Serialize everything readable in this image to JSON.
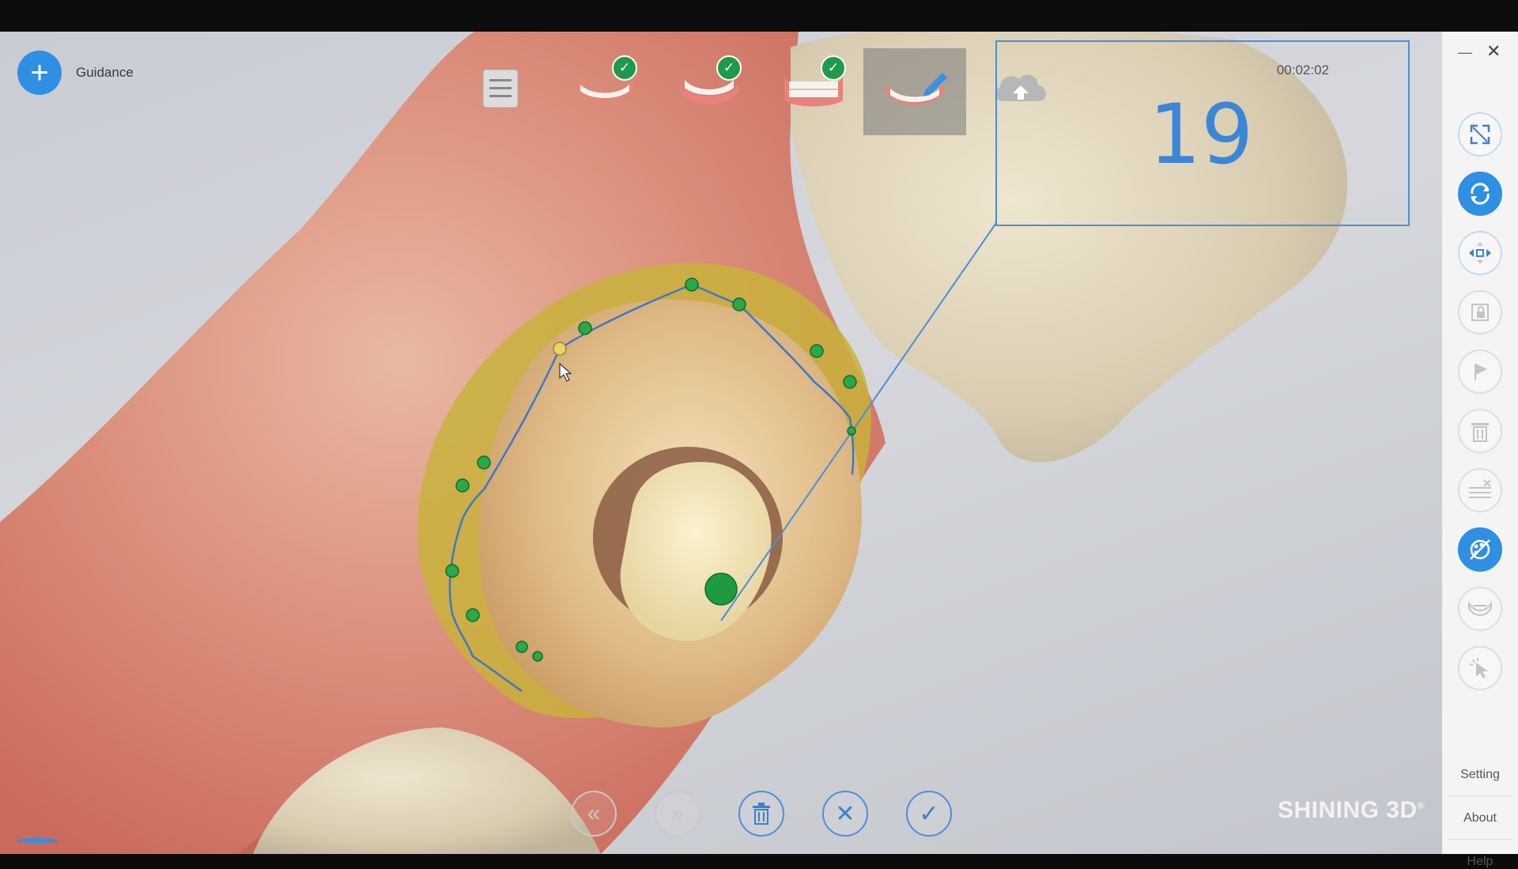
{
  "app": {
    "guidance_label": "Guidance",
    "brand": "SHINING 3D",
    "brand_mark": "®",
    "accent_color": "#2f8fe3"
  },
  "top_toolbar": {
    "stages": [
      {
        "icon": "list-icon",
        "completed": false
      },
      {
        "icon": "upper-jaw-icon",
        "completed": true
      },
      {
        "icon": "lower-jaw-icon",
        "completed": true
      },
      {
        "icon": "bite-icon",
        "completed": true
      },
      {
        "icon": "edit-margin-icon",
        "completed": false,
        "active": true
      },
      {
        "icon": "cloud-upload-icon",
        "completed": false
      }
    ]
  },
  "magnifier": {
    "timer": "00:02:02",
    "tooth_number": "19"
  },
  "bottom_toolbar": {
    "buttons": [
      {
        "icon": "undo-icon",
        "enabled": false
      },
      {
        "icon": "redo-icon",
        "enabled": false
      },
      {
        "icon": "delete-icon",
        "enabled": true
      },
      {
        "icon": "cancel-icon",
        "enabled": true
      },
      {
        "icon": "confirm-icon",
        "enabled": true
      }
    ]
  },
  "right_panel": {
    "tools": [
      "fit-view-icon",
      "rotate-icon",
      "pan-icon",
      "lock-icon",
      "flag-icon",
      "trash-icon",
      "clear-layers-icon",
      "color-texture-icon",
      "jaw-icon",
      "select-icon"
    ],
    "links": {
      "setting": "Setting",
      "about": "About",
      "help": "Help"
    }
  }
}
